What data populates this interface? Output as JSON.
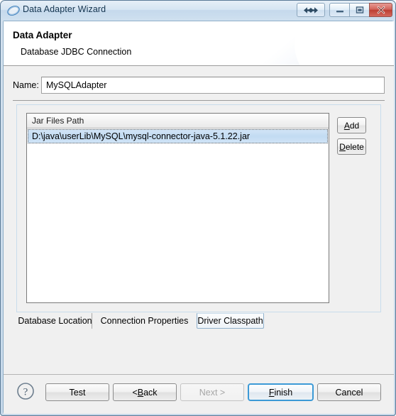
{
  "window": {
    "title": "Data Adapter Wizard",
    "icon": "oval-blue-icon",
    "controls": {
      "resize": "resize-arrows-icon",
      "minimize": "minimize-icon",
      "maximize": "maximize-icon",
      "close": "close-icon"
    }
  },
  "header": {
    "title": "Data Adapter",
    "subtitle": "Database JDBC Connection"
  },
  "form": {
    "name_label": "Name:",
    "name_value": "MySQLAdapter",
    "name_placeholder": ""
  },
  "jar_list": {
    "column_header": "Jar Files Path",
    "rows": [
      "D:\\java\\userLib\\MySQL\\mysql-connector-java-5.1.22.jar"
    ],
    "buttons": {
      "add": {
        "mnemonic": "A",
        "rest": "dd"
      },
      "delete": {
        "mnemonic": "D",
        "rest": "elete"
      }
    }
  },
  "tabs": [
    {
      "label": "Database Location",
      "active": false
    },
    {
      "label": "Connection Properties",
      "active": false
    },
    {
      "label": "Driver Classpath",
      "active": true
    }
  ],
  "footer": {
    "help": "help-icon",
    "test": "Test",
    "back": {
      "prefix": "< ",
      "mnemonic": "B",
      "rest": "ack"
    },
    "next": "Next >",
    "finish": {
      "mnemonic": "F",
      "rest": "inish"
    },
    "cancel": "Cancel"
  },
  "colors": {
    "accent": "#3c9ad6",
    "titlebar": "#cfe0ef",
    "close_button": "#bd3f33",
    "selection": "#c2dbf2",
    "panel": "#f0f0f0"
  }
}
